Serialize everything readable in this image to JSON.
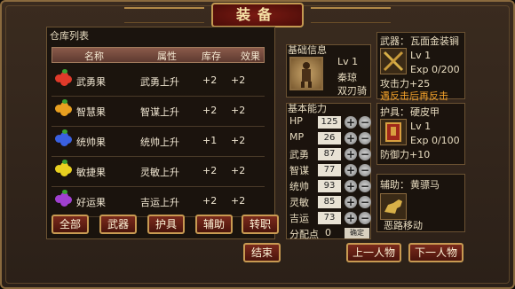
{
  "title": "装备",
  "warehouse": {
    "title": "仓库列表",
    "headers": [
      "名称",
      "属性",
      "库存",
      "效果"
    ],
    "items": [
      {
        "name": "武勇果",
        "attr": "武勇上升",
        "stock": "+2",
        "effect": "+2",
        "color": "#e03a2a"
      },
      {
        "name": "智慧果",
        "attr": "智谋上升",
        "stock": "+2",
        "effect": "+2",
        "color": "#e8a020"
      },
      {
        "name": "统帅果",
        "attr": "统帅上升",
        "stock": "+1",
        "effect": "+2",
        "color": "#3a60e0"
      },
      {
        "name": "敏捷果",
        "attr": "灵敏上升",
        "stock": "+2",
        "effect": "+2",
        "color": "#e8d020"
      },
      {
        "name": "好运果",
        "attr": "吉运上升",
        "stock": "+2",
        "effect": "+2",
        "color": "#a040d0"
      }
    ]
  },
  "filter_buttons": [
    "全部",
    "武器",
    "护具",
    "辅助",
    "转职"
  ],
  "end_button": "结束",
  "basic_info": {
    "title": "基础信息",
    "level": "Lv 1",
    "name": "秦琼",
    "weapon_type": "双刃骑"
  },
  "basic_ability": {
    "title": "基本能力",
    "stats": [
      {
        "label": "HP",
        "value": "125"
      },
      {
        "label": "MP",
        "value": "26"
      },
      {
        "label": "武勇",
        "value": "87"
      },
      {
        "label": "智谋",
        "value": "77"
      },
      {
        "label": "统帅",
        "value": "93"
      },
      {
        "label": "灵敏",
        "value": "85"
      },
      {
        "label": "吉运",
        "value": "73"
      }
    ],
    "points_label": "分配点",
    "points_value": "0",
    "confirm": "确定"
  },
  "weapon": {
    "label": "武器：",
    "name": "瓦面金装锏",
    "level": "Lv  1",
    "exp": "Exp 0/200",
    "attack": "攻击力+25",
    "special": "遇反击后再反击"
  },
  "armor": {
    "label": "护具：",
    "name": "硬皮甲",
    "level": "Lv  1",
    "exp": "Exp 0/100",
    "defense": "防御力+10"
  },
  "accessory": {
    "label": "辅助：",
    "name": "黄骠马",
    "effect": "恶路移动"
  },
  "prev_button": "上一人物",
  "next_button": "下一人物"
}
